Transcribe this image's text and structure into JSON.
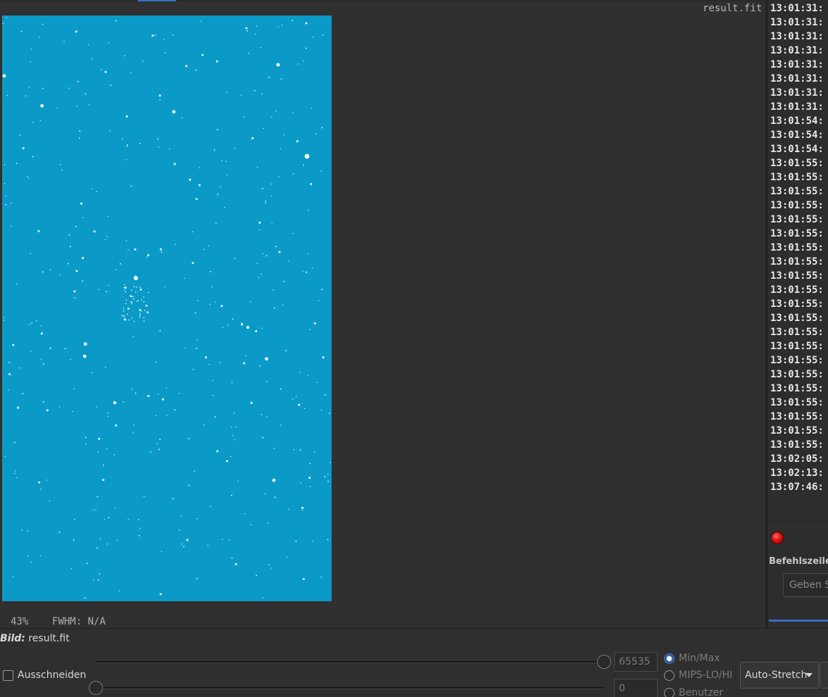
{
  "image_view": {
    "filename": "result.fit",
    "zoom": "43%",
    "fwhm": "FWHM: N/A",
    "background_color": "#0b9ac8"
  },
  "console": {
    "log_lines": [
      "13:01:31:",
      "13:01:31:",
      "13:01:31:",
      "13:01:31:",
      "13:01:31:",
      "13:01:31:",
      "13:01:31:",
      "13:01:31:",
      "13:01:54:",
      "13:01:54:",
      "13:01:54:",
      "13:01:55:",
      "13:01:55:",
      "13:01:55:",
      "13:01:55:",
      "13:01:55:",
      "13:01:55:",
      "13:01:55:",
      "13:01:55:",
      "13:01:55:",
      "13:01:55:",
      "13:01:55:",
      "13:01:55:",
      "13:01:55:",
      "13:01:55:",
      "13:01:55:",
      "13:01:55:",
      "13:01:55:",
      "13:01:55:",
      "13:01:55:",
      "13:01:55:",
      "13:01:55:",
      "13:02:05:",
      "13:02:13:",
      "13:07:46:"
    ],
    "command_label": "Befehlszeile",
    "command_placeholder": "Geben Sie"
  },
  "bottom": {
    "bild_label": "Bild:",
    "bild_value": "result.fit",
    "crop_label": "Ausschneiden",
    "high_value": "65535",
    "low_value": "0",
    "high_slider_level": 1.0,
    "low_slider_level": 0.0,
    "radio_options": [
      "Min/Max",
      "MIPS-LO/HI",
      "Benutzer"
    ],
    "radio_selected": "Min/Max",
    "stretch_mode": "Auto-Stretch"
  },
  "colors": {
    "accent": "#3a6fc4",
    "stop_indicator": "#e01010"
  }
}
